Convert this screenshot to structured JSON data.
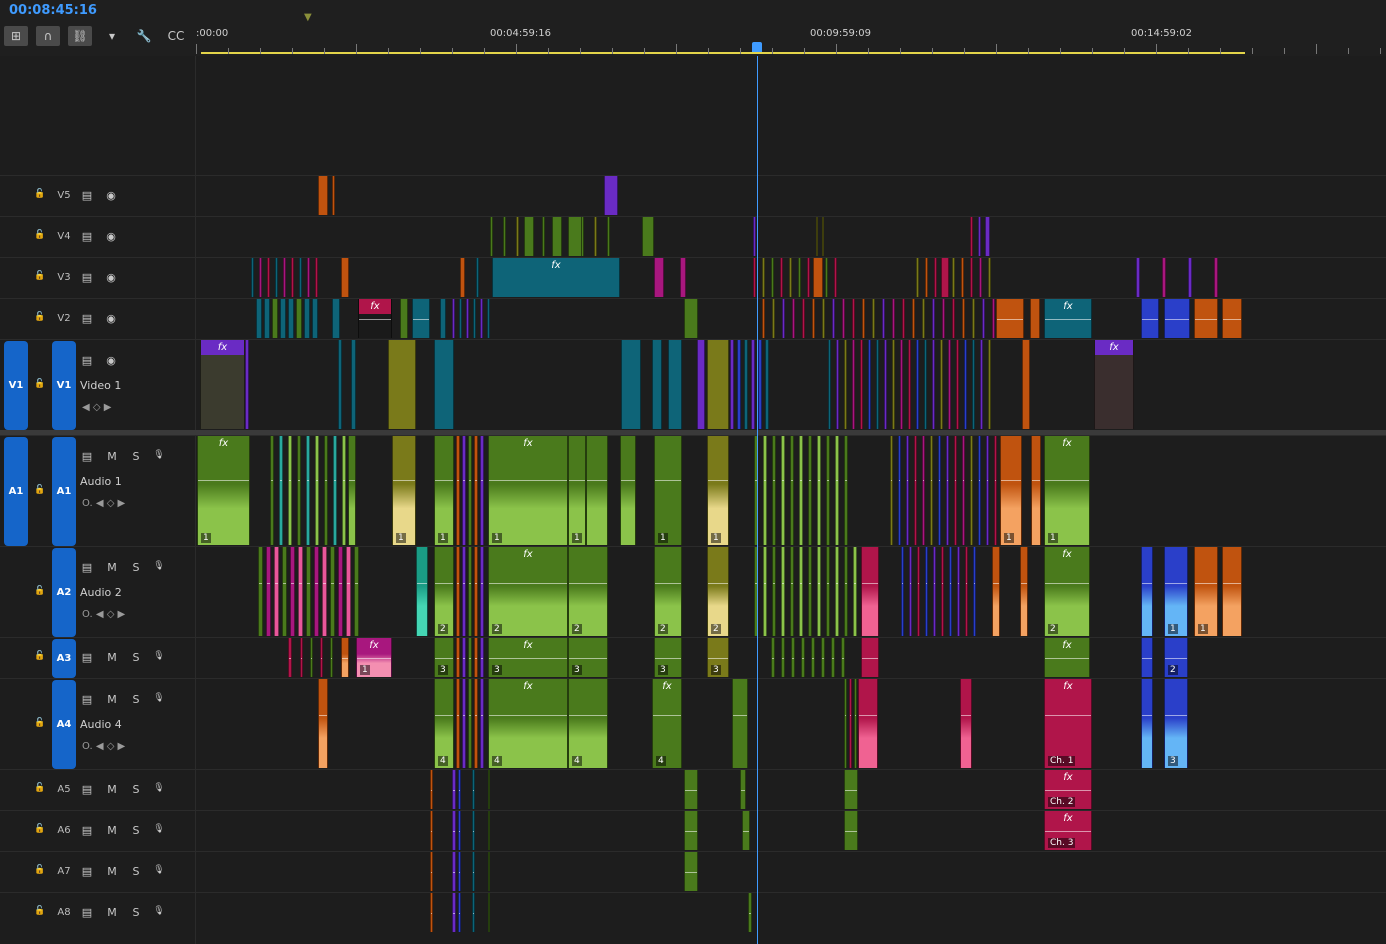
{
  "timecode": "00:08:45:16",
  "toolbar": {
    "tools": [
      {
        "name": "insert-nest-tool",
        "glyph": "⊞"
      },
      {
        "name": "snap-tool",
        "glyph": "∩"
      },
      {
        "name": "linked-selection-tool",
        "glyph": "⛓"
      },
      {
        "name": "add-marker-tool",
        "glyph": "▾"
      },
      {
        "name": "settings-wrench-tool",
        "glyph": "🔧"
      },
      {
        "name": "captions-tool",
        "glyph": "CC"
      }
    ]
  },
  "ruler": {
    "labels": [
      ":00:00",
      "00:04:59:16",
      "00:09:59:09",
      "00:14:59:02"
    ]
  },
  "tracks": {
    "video": [
      {
        "id": "V5",
        "label": "V5"
      },
      {
        "id": "V4",
        "label": "V4"
      },
      {
        "id": "V3",
        "label": "V3"
      },
      {
        "id": "V2",
        "label": "V2"
      },
      {
        "id": "V1",
        "label": "V1",
        "source": "V1",
        "name": "Video 1"
      }
    ],
    "audio": [
      {
        "id": "A1",
        "label": "A1",
        "source": "A1",
        "name": "Audio 1"
      },
      {
        "id": "A2",
        "label": "A2",
        "name": "Audio 2"
      },
      {
        "id": "A3",
        "label": "A3"
      },
      {
        "id": "A4",
        "label": "A4",
        "name": "Audio 4"
      },
      {
        "id": "A5",
        "label": "A5"
      },
      {
        "id": "A6",
        "label": "A6"
      },
      {
        "id": "A7",
        "label": "A7"
      },
      {
        "id": "A8",
        "label": "A8"
      }
    ]
  },
  "mute_label": "M",
  "solo_label": "S",
  "fx_label": "fx",
  "colors": {
    "green": "#4a7a1c",
    "lightgreen": "#8bc34a",
    "teal": "#0e6478",
    "purple": "#6a2bc4",
    "magenta": "#a8177e",
    "orange": "#c0530f",
    "olive": "#7a7a1a",
    "crimson": "#b0154a",
    "blue": "#2a3fc9",
    "yellow": "#e8d88a",
    "playhead": "#3f9bff",
    "timecode": "#3f9bff"
  },
  "clip_labels": {
    "a1": [
      "1",
      "1",
      "1",
      "1",
      "1",
      "1",
      "1",
      "1",
      "1"
    ],
    "a2": [
      "2",
      "2",
      "2",
      "2",
      "2",
      "1",
      "1"
    ],
    "a3": [
      "1",
      "3",
      "3",
      "3",
      "3",
      "3",
      "2"
    ],
    "a4": [
      "4",
      "4",
      "4",
      "4",
      "Ch. 1",
      "3"
    ],
    "a5": [
      "Ch. 2"
    ],
    "a6": [
      "Ch. 3"
    ]
  }
}
